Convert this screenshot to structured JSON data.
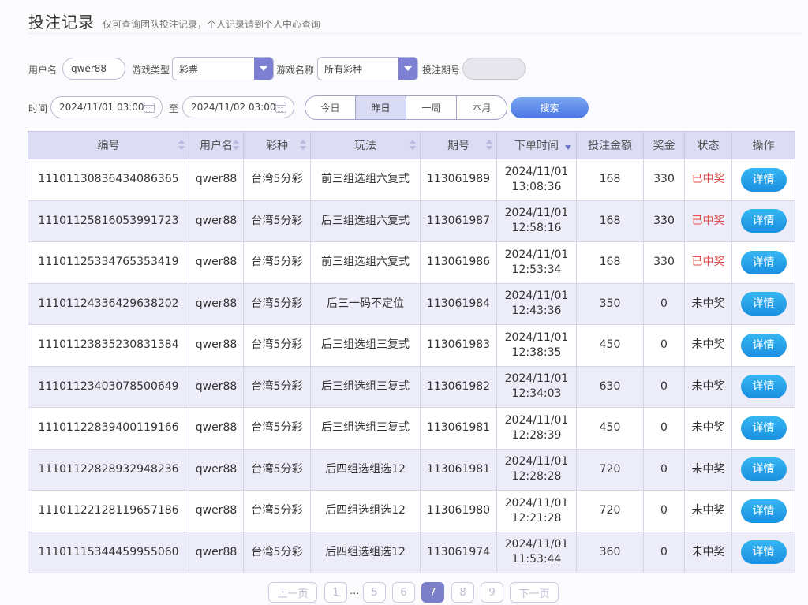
{
  "header": {
    "title": "投注记录",
    "subtitle": "仅可查询团队投注记录，个人记录请到个人中心查询"
  },
  "filters": {
    "username_label": "用户名",
    "username_value": "qwer88",
    "game_type_label": "游戏类型",
    "game_type_value": "彩票",
    "game_name_label": "游戏名称",
    "game_name_value": "所有彩种",
    "period_label": "投注期号",
    "period_value": "",
    "time_label": "时间",
    "start_time": "2024/11/01 03:00",
    "to_label": "至",
    "end_time": "2024/11/02 03:00",
    "quick_ranges": [
      "今日",
      "昨日",
      "一周",
      "本月"
    ],
    "active_range": "昨日",
    "search_label": "搜索"
  },
  "table": {
    "headers": [
      "编号",
      "用户名",
      "彩种",
      "玩法",
      "期号",
      "下单时间",
      "投注金额",
      "奖金",
      "状态",
      "操作"
    ],
    "detail_label": "详情",
    "rows": [
      {
        "id": "11101130836434086365",
        "user": "qwer88",
        "lottery": "台湾5分彩",
        "play": "前三组选组六复式",
        "period": "113061989",
        "date": "2024/11/01",
        "time": "13:08:36",
        "amount": "168",
        "bonus": "330",
        "status": "已中奖"
      },
      {
        "id": "11101125816053991723",
        "user": "qwer88",
        "lottery": "台湾5分彩",
        "play": "后三组选组六复式",
        "period": "113061987",
        "date": "2024/11/01",
        "time": "12:58:16",
        "amount": "168",
        "bonus": "330",
        "status": "已中奖"
      },
      {
        "id": "11101125334765353419",
        "user": "qwer88",
        "lottery": "台湾5分彩",
        "play": "前三组选组六复式",
        "period": "113061986",
        "date": "2024/11/01",
        "time": "12:53:34",
        "amount": "168",
        "bonus": "330",
        "status": "已中奖"
      },
      {
        "id": "11101124336429638202",
        "user": "qwer88",
        "lottery": "台湾5分彩",
        "play": "后三一码不定位",
        "period": "113061984",
        "date": "2024/11/01",
        "time": "12:43:36",
        "amount": "350",
        "bonus": "0",
        "status": "未中奖"
      },
      {
        "id": "11101123835230831384",
        "user": "qwer88",
        "lottery": "台湾5分彩",
        "play": "后三组选组三复式",
        "period": "113061983",
        "date": "2024/11/01",
        "time": "12:38:35",
        "amount": "450",
        "bonus": "0",
        "status": "未中奖"
      },
      {
        "id": "11101123403078500649",
        "user": "qwer88",
        "lottery": "台湾5分彩",
        "play": "后三组选组三复式",
        "period": "113061982",
        "date": "2024/11/01",
        "time": "12:34:03",
        "amount": "630",
        "bonus": "0",
        "status": "未中奖"
      },
      {
        "id": "11101122839400119166",
        "user": "qwer88",
        "lottery": "台湾5分彩",
        "play": "后三组选组三复式",
        "period": "113061981",
        "date": "2024/11/01",
        "time": "12:28:39",
        "amount": "450",
        "bonus": "0",
        "status": "未中奖"
      },
      {
        "id": "11101122828932948236",
        "user": "qwer88",
        "lottery": "台湾5分彩",
        "play": "后四组选组选12",
        "period": "113061981",
        "date": "2024/11/01",
        "time": "12:28:28",
        "amount": "720",
        "bonus": "0",
        "status": "未中奖"
      },
      {
        "id": "11101122128119657186",
        "user": "qwer88",
        "lottery": "台湾5分彩",
        "play": "后四组选组选12",
        "period": "113061980",
        "date": "2024/11/01",
        "time": "12:21:28",
        "amount": "720",
        "bonus": "0",
        "status": "未中奖"
      },
      {
        "id": "11101115344459955060",
        "user": "qwer88",
        "lottery": "台湾5分彩",
        "play": "后四组选组选12",
        "period": "113061974",
        "date": "2024/11/01",
        "time": "11:53:44",
        "amount": "360",
        "bonus": "0",
        "status": "未中奖"
      }
    ]
  },
  "pagination": {
    "prev_label": "上一页",
    "next_label": "下一页",
    "first_page": "1",
    "ellipsis": "...",
    "pages": [
      "5",
      "6",
      "7",
      "8",
      "9"
    ],
    "current_page": "7"
  },
  "colors": {
    "accent": "#7d7fd3",
    "won_status": "#e24a4a",
    "detail_button": "#1a8fe0",
    "header_bg": "#dcdcf5"
  }
}
